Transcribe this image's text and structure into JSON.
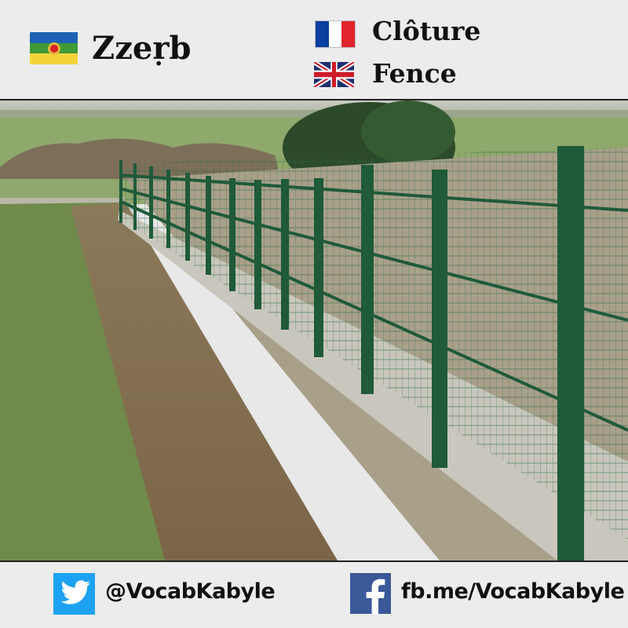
{
  "header": {
    "kabyle_word": "Zzeṛb",
    "french_word": "Clôture",
    "english_word": "Fence",
    "flags": {
      "kabyle": {
        "colors": [
          "#1e63b5",
          "#3f9b35",
          "#f2d43a"
        ]
      },
      "france": {
        "colors": [
          "#0b3fa0",
          "#ffffff",
          "#e1232d"
        ]
      },
      "uk": {
        "colors": [
          "#1e2f6e",
          "#ffffff",
          "#cf1b2b"
        ]
      }
    }
  },
  "photo": {
    "subject": "fence",
    "fence_color": "#1f5a39"
  },
  "footer": {
    "twitter_handle": "@VocabKabyle",
    "facebook_link": "fb.me/VocabKabyle",
    "twitter_color": "#1da1f2",
    "facebook_color": "#3b5998"
  }
}
